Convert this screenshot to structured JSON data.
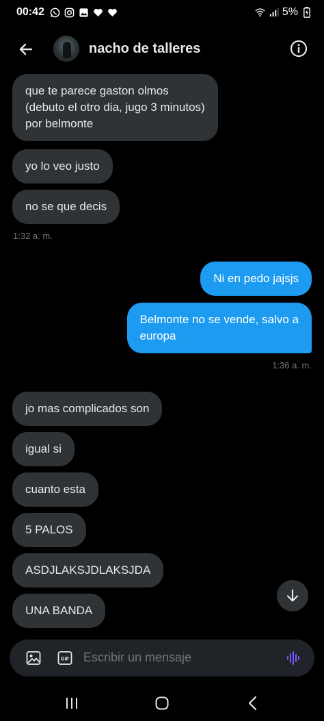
{
  "status_bar": {
    "time": "00:42",
    "battery": "5%",
    "icons": [
      "whatsapp-icon",
      "instagram-icon",
      "gallery-icon",
      "heart-icon",
      "heart-icon",
      "wifi-icon",
      "signal-icon",
      "battery-icon"
    ]
  },
  "header": {
    "name": "nacho de talleres",
    "back_icon": "arrow-left-icon",
    "info_icon": "info-icon"
  },
  "messages": [
    {
      "dir": "in",
      "lines": [
        "que te parece gaston olmos",
        "(debuto el otro dia, jugo 3 minutos)",
        "por belmonte"
      ]
    },
    {
      "dir": "in",
      "lines": [
        "yo lo veo justo"
      ]
    },
    {
      "dir": "in",
      "lines": [
        "no se que decis"
      ]
    },
    {
      "dir": "out",
      "lines": [
        "Ni en pedo jajsjs"
      ]
    },
    {
      "dir": "out",
      "lines": [
        "Belmonte no se vende, salvo a",
        "europa"
      ]
    },
    {
      "dir": "in",
      "lines": [
        "jo mas complicados son"
      ]
    },
    {
      "dir": "in",
      "lines": [
        "igual si"
      ]
    },
    {
      "dir": "in",
      "lines": [
        "cuanto esta"
      ]
    },
    {
      "dir": "in",
      "lines": [
        "5 PALOS"
      ]
    },
    {
      "dir": "in",
      "lines": [
        "ASDJLAKSJDLAKSJDA"
      ]
    },
    {
      "dir": "in",
      "lines": [
        "UNA BANDA"
      ]
    }
  ],
  "timestamps": [
    "1:32 a. m.",
    "1:36 a. m."
  ],
  "composer": {
    "placeholder": "Escribir un mensaje",
    "icons": [
      "image-icon",
      "gif-icon",
      "voice-icon"
    ]
  },
  "navbar": {
    "icons": [
      "recent-apps-icon",
      "home-icon",
      "back-icon"
    ]
  },
  "colors": {
    "background": "#000000",
    "incoming_bubble": "#2f3336",
    "outgoing_bubble": "#1d9bf0",
    "voice_accent": "#7856ff"
  }
}
